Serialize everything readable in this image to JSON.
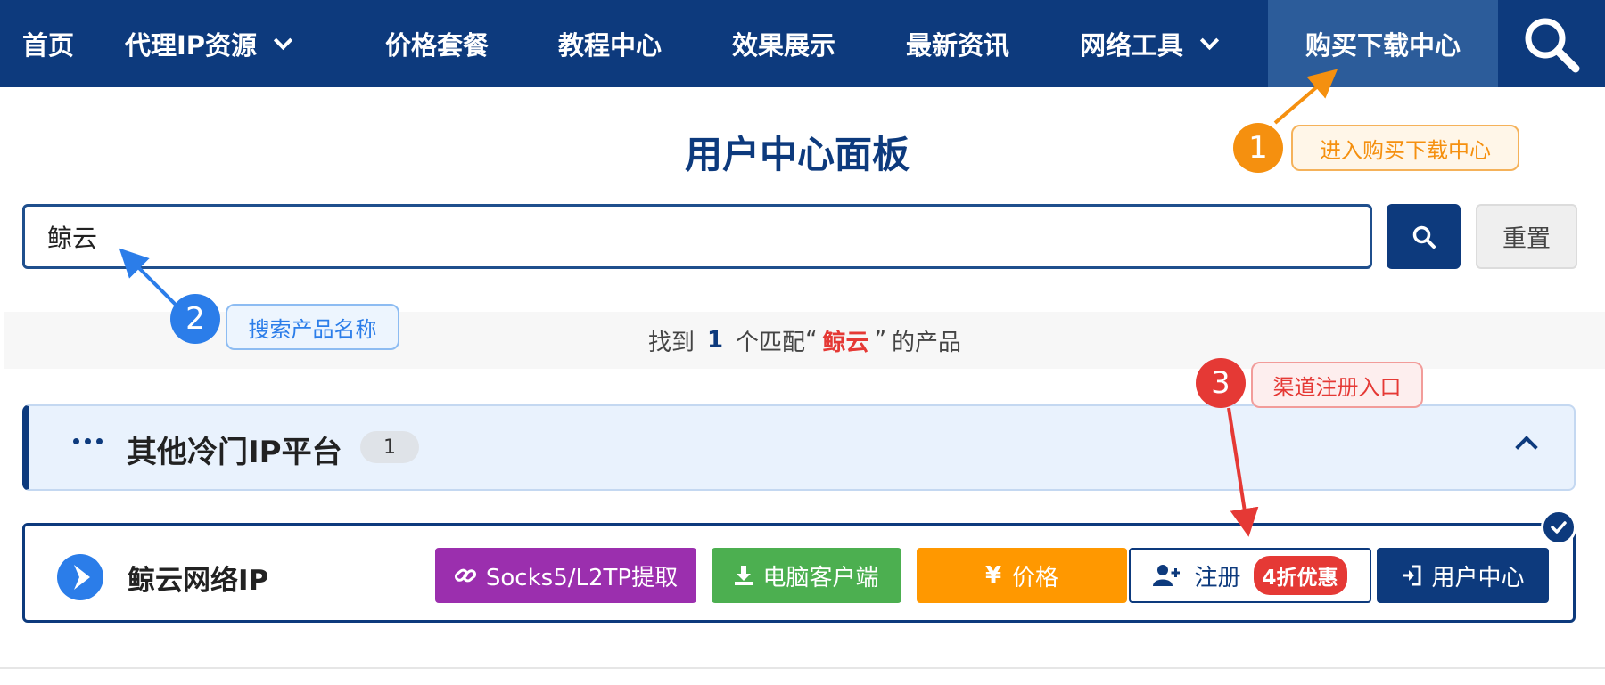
{
  "nav": {
    "items": [
      {
        "label": "首页"
      },
      {
        "label": "代理IP资源"
      },
      {
        "label": "价格套餐"
      },
      {
        "label": "教程中心"
      },
      {
        "label": "效果展示"
      },
      {
        "label": "最新资讯"
      },
      {
        "label": "网络工具"
      },
      {
        "label": "购买下载中心"
      }
    ],
    "active": "购买下载中心",
    "search_icon": "search-icon"
  },
  "page": {
    "title": "用户中心面板"
  },
  "search": {
    "value": "鲸云",
    "reset_label": "重置"
  },
  "result": {
    "prefix": "找到",
    "count": "1",
    "middle": "个匹配",
    "open_quote": "“",
    "keyword": "鲸云",
    "close_quote": "”",
    "suffix": "的产品"
  },
  "category": {
    "title": "其他冷门IP平台",
    "count": "1"
  },
  "product": {
    "name": "鲸云网络IP",
    "socks_label": "Socks5/L2TP提取",
    "client_label": "电脑客户端",
    "price_label": "价格",
    "price_symbol": "¥",
    "register_label": "注册",
    "discount_label": "4折优惠",
    "user_center_label": "用户中心"
  },
  "annotations": [
    {
      "number": "1",
      "label": "进入购买下载中心",
      "color": "#f5900f"
    },
    {
      "number": "2",
      "label": "搜索产品名称",
      "color": "#2b7de9"
    },
    {
      "number": "3",
      "label": "渠道注册入口",
      "color": "#e53935"
    }
  ],
  "colors": {
    "brand": "#0d3a7d",
    "socks": "#9b2fae",
    "client": "#4caf50",
    "price": "#ff9800",
    "discount": "#e53935"
  }
}
